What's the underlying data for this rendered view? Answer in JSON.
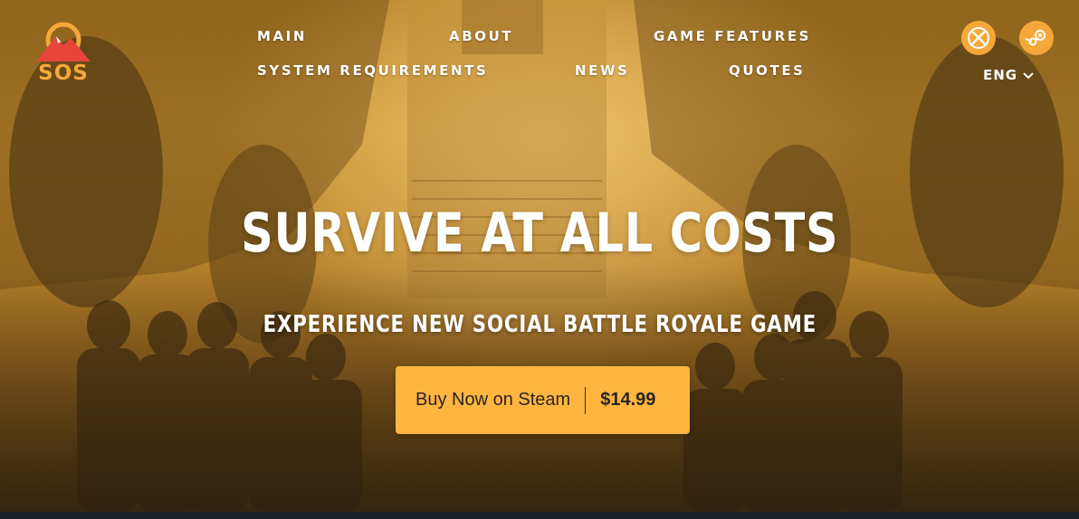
{
  "logo": {
    "text": "SOS"
  },
  "nav": {
    "items": [
      {
        "label": "MAIN"
      },
      {
        "label": "ABOUT"
      },
      {
        "label": "GAME FEATURES"
      },
      {
        "label": "SYSTEM REQUIREMENTS"
      },
      {
        "label": "NEWS"
      },
      {
        "label": "QUOTES"
      }
    ]
  },
  "platforms": [
    {
      "icon": "xbox-icon"
    },
    {
      "icon": "steam-icon"
    }
  ],
  "language": {
    "current": "ENG"
  },
  "hero": {
    "headline": "SURVIVE AT ALL COSTS",
    "subheadline": "EXPERIENCE NEW SOCIAL BATTLE ROYALE GAME",
    "cta": {
      "label": "Buy Now on Steam",
      "price": "$14.99"
    }
  },
  "colors": {
    "accent": "#ffb540",
    "icon_bg": "#f5a83a",
    "logo_red": "#e8443a",
    "footer": "#1c2228"
  }
}
